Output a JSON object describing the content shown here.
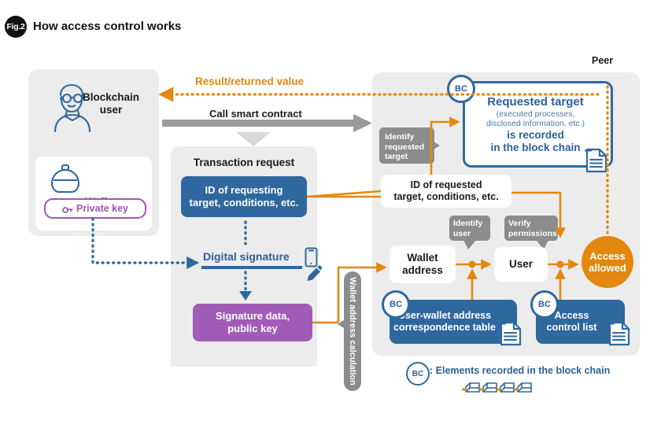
{
  "figure": {
    "badge": "Fig.2",
    "title": "How access control works"
  },
  "colors": {
    "blue": "#2f689e",
    "blue_text": "#2d6098",
    "orange": "#e3880e",
    "purple": "#a05cb6",
    "gray_callout": "#8c8c8c",
    "panel_bg": "#ececec",
    "gray_arrow": "#9a9a9a"
  },
  "left_panel": {
    "user_label": "Blockchain\nuser",
    "user_label_line1": "Blockchain",
    "user_label_line2": "user",
    "user_icon": "person-avatar-icon",
    "wallet_label": "Wallet",
    "wallet_icon": "wallet-purse-icon",
    "private_key_label": "Private key",
    "private_key_icon": "key-icon"
  },
  "flows": {
    "result_returned_value": "Result/returned value",
    "call_smart_contract": "Call smart contract"
  },
  "transaction_panel": {
    "title": "Transaction request",
    "id_box_line1": "ID of requesting",
    "id_box_line2": "target, conditions, etc.",
    "digital_signature": "Digital signature",
    "phone_icon": "smartphone-icon",
    "pencil_icon": "pencil-icon",
    "signature_box_line1": "Signature data,",
    "signature_box_line2": "public key"
  },
  "wallet_calculation": {
    "label": "Wallet address calculation"
  },
  "peer_panel": {
    "title": "Peer",
    "requested_target": {
      "line1": "Requested target",
      "line2": "(executed processes,",
      "line3": "disclosed information, etc.)",
      "line4": "is recorded",
      "line5": "in the block chain",
      "doc_icon": "document-icon",
      "bc_badge": "BC"
    },
    "callouts": {
      "identify_requested_target": "Identify\nrequested\ntarget",
      "identify_requested_target_l1": "Identify",
      "identify_requested_target_l2": "requested",
      "identify_requested_target_l3": "target",
      "identify_user_l1": "Identify",
      "identify_user_l2": "user",
      "verify_permissions_l1": "Verify",
      "verify_permissions_l2": "permissions"
    },
    "id_requested_box": {
      "line1": "ID of requested",
      "line2": "target, conditions, etc."
    },
    "wallet_address_l1": "Wallet",
    "wallet_address_l2": "address",
    "user_box": "User",
    "access_allowed_l1": "Access",
    "access_allowed_l2": "allowed",
    "uw_table_l1": "User-wallet address",
    "uw_table_l2": "correspondence table",
    "uw_table_bc": "BC",
    "uw_table_doc_icon": "document-icon",
    "acl_l1": "Access",
    "acl_l2": "control list",
    "acl_bc": "BC",
    "acl_doc_icon": "document-icon"
  },
  "legend": {
    "bc_badge": "BC",
    "text": ": Elements recorded in the block chain",
    "chain_icon": "block-chain-icon"
  }
}
